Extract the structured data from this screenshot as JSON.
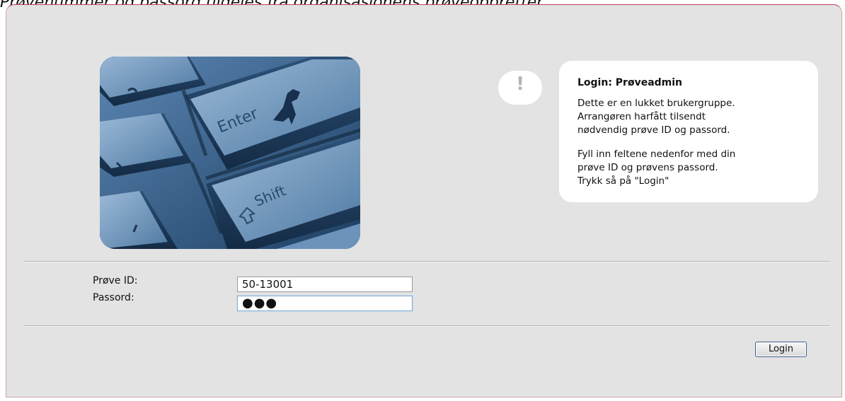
{
  "caption": "Prøvenummer og passord tildeles fra organisasjonens prøveoppretter",
  "info": {
    "title": "Login: Prøveadmin",
    "paragraph1": [
      "Dette er en lukket brukergruppe.",
      "Arrangøren harfått tilsendt",
      "nødvendig prøve ID og passord."
    ],
    "paragraph2": [
      "Fyll inn feltene nedenfor med din",
      "prøve ID og prøvens passord.",
      "Trykk så på \"Login\""
    ]
  },
  "alert_icon": {
    "name": "exclamation-icon",
    "glyph": "!"
  },
  "keyboard_image": {
    "name": "keyboard-photo",
    "key_labels": [
      "Enter",
      "Shift"
    ]
  },
  "form": {
    "id_label": "Prøve ID:",
    "id_value": "50-13001",
    "password_label": "Passord:",
    "password_value": "●●●"
  },
  "login_button": {
    "label": "Login"
  },
  "colors": {
    "panel_background": "#e3e3e3",
    "panel_border_accent": "#c0405a",
    "keyboard_tint": "#3f6b96",
    "button_border": "#3b5f86",
    "focus_border": "#7fa7c9"
  }
}
